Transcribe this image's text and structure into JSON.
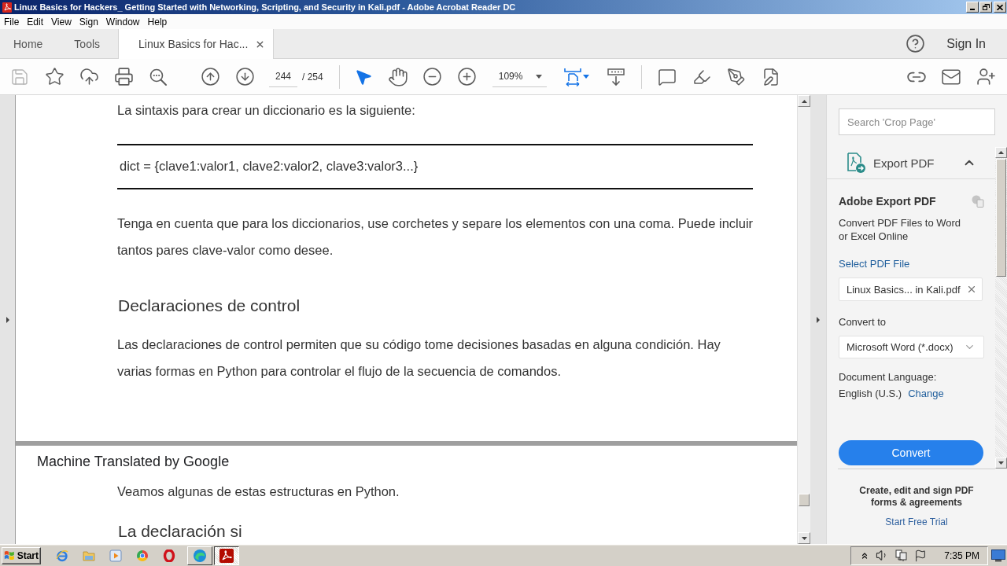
{
  "window": {
    "title": "Linux Basics for Hackers_ Getting Started with Networking, Scripting, and Security in Kali.pdf - Adobe Acrobat Reader DC"
  },
  "menu": [
    "File",
    "Edit",
    "View",
    "Sign",
    "Window",
    "Help"
  ],
  "tabs": [
    {
      "label": "Home",
      "selected": false,
      "closable": false
    },
    {
      "label": "Tools",
      "selected": false,
      "closable": false
    },
    {
      "label": "Linux Basics for Hac...",
      "selected": true,
      "closable": true
    }
  ],
  "account": {
    "sign_in": "Sign In"
  },
  "toolbar": {
    "page": "244",
    "page_count": "/ 254",
    "zoom": "109%",
    "pointer_tools": [
      {
        "selected": true
      },
      {
        "selected": false
      }
    ]
  },
  "document": {
    "pages": [
      {
        "blocks": [
          {
            "kind": "text",
            "lines": [
              "La sintaxis para crear un diccionario es la siguiente:"
            ]
          },
          {
            "kind": "code",
            "lines": [
              "dict = {clave1:valor1, clave2:valor2, clave3:valor3...}"
            ]
          },
          {
            "kind": "paragraph",
            "lines": [
              "Tenga en cuenta que para los diccionarios, use corchetes y separe los elementos con una coma. Puede incluir",
              "tantos pares clave-valor como desee."
            ]
          },
          {
            "kind": "heading",
            "lines": [
              "Declaraciones de control"
            ]
          },
          {
            "kind": "paragraph",
            "lines": [
              "Las declaraciones de control permiten que su código tome decisiones basadas en alguna condición. Hay",
              "varias formas en Python para controlar el flujo de la secuencia de comandos."
            ]
          }
        ]
      },
      {
        "blocks": [
          {
            "kind": "banner",
            "lines": [
              "Machine Translated by Google"
            ]
          },
          {
            "kind": "text",
            "lines": [
              "Veamos algunas de estas estructuras en Python."
            ]
          },
          {
            "kind": "heading",
            "lines": [
              "La declaración si"
            ]
          }
        ]
      }
    ]
  },
  "tools_panel": {
    "search": {
      "placeholder": "Search 'Crop Page'"
    },
    "section": {
      "title": "Export PDF",
      "expanded": true
    },
    "heading": "Adobe Export PDF",
    "description": "Convert PDF Files to Word or Excel Online",
    "select_link": "Select PDF File",
    "file": {
      "value": "Linux Basics... in Kali.pdf"
    },
    "convert_label": "Convert to",
    "format": {
      "value": "Microsoft Word (*.docx)"
    },
    "language_label": "Document Language:",
    "language": "English (U.S.)",
    "change_link": "Change",
    "button": "Convert",
    "promo": {
      "text": "Create, edit and sign PDF forms & agreements",
      "link": "Start Free Trial"
    }
  },
  "taskbar": {
    "start": "Start",
    "windows": [
      {
        "kind": "browser",
        "selected": false
      },
      {
        "kind": "pdf",
        "selected": true
      }
    ],
    "clock": "7:35 PM"
  }
}
